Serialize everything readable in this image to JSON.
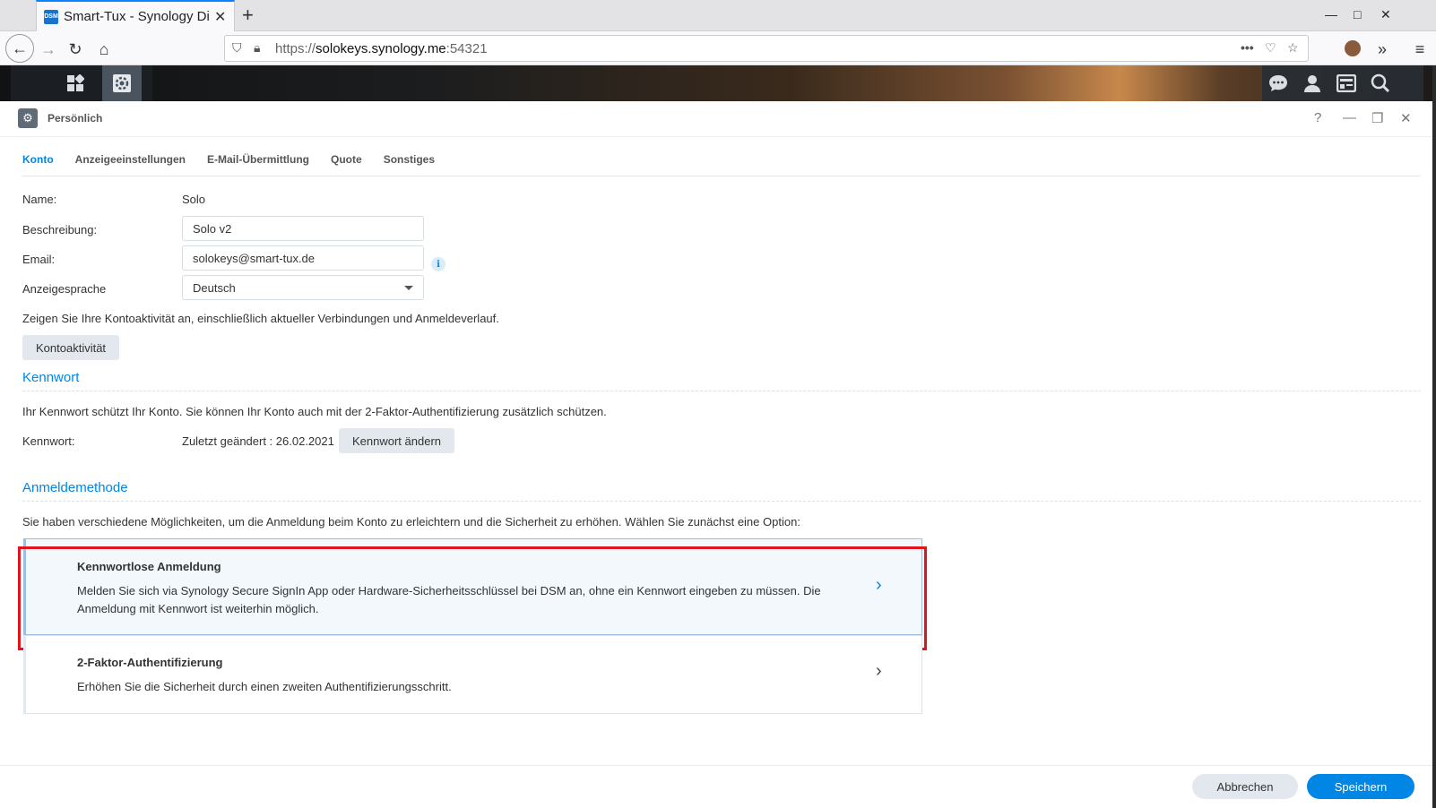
{
  "browser": {
    "tab_title": "Smart-Tux - Synology Dis",
    "favicon_text": "DSM",
    "url_prefix": "https://",
    "url_host": "solokeys.synology.me",
    "url_port": ":54321"
  },
  "window": {
    "title": "Persönlich",
    "tabs": [
      {
        "label": "Konto",
        "active": true
      },
      {
        "label": "Anzeigeeinstellungen"
      },
      {
        "label": "E-Mail-Übermittlung"
      },
      {
        "label": "Quote"
      },
      {
        "label": "Sonstiges"
      }
    ]
  },
  "account": {
    "name_label": "Name:",
    "name_value": "Solo",
    "description_label": "Beschreibung:",
    "description_value": "Solo v2",
    "email_label": "Email:",
    "email_value": "solokeys@smart-tux.de",
    "language_label": "Anzeigesprache",
    "language_value": "Deutsch",
    "activity_text": "Zeigen Sie Ihre Kontoaktivität an, einschließlich aktueller Verbindungen und Anmeldeverlauf.",
    "activity_button": "Kontoaktivität"
  },
  "password": {
    "section_title": "Kennwort",
    "description": "Ihr Kennwort schützt Ihr Konto. Sie können Ihr Konto auch mit der 2-Faktor-Authentifizierung zusätzlich schützen.",
    "label": "Kennwort:",
    "last_changed": "Zuletzt geändert : 26.02.2021",
    "change_button": "Kennwort ändern"
  },
  "login_method": {
    "section_title": "Anmeldemethode",
    "description": "Sie haben verschiedene Möglichkeiten, um die Anmeldung beim Konto zu erleichtern und die Sicherheit zu erhöhen. Wählen Sie zunächst eine Option:",
    "options": [
      {
        "title": "Kennwortlose Anmeldung",
        "description": "Melden Sie sich via Synology Secure SignIn App oder Hardware-Sicherheitsschlüssel bei DSM an, ohne ein Kennwort eingeben zu müssen. Die Anmeldung mit Kennwort ist weiterhin möglich."
      },
      {
        "title": "2-Faktor-Authentifizierung",
        "description": "Erhöhen Sie die Sicherheit durch einen zweiten Authentifizierungsschritt."
      }
    ]
  },
  "footer": {
    "cancel": "Abbrechen",
    "save": "Speichern"
  },
  "colors": {
    "accent": "#0086e5",
    "highlight": "#e3121b"
  }
}
